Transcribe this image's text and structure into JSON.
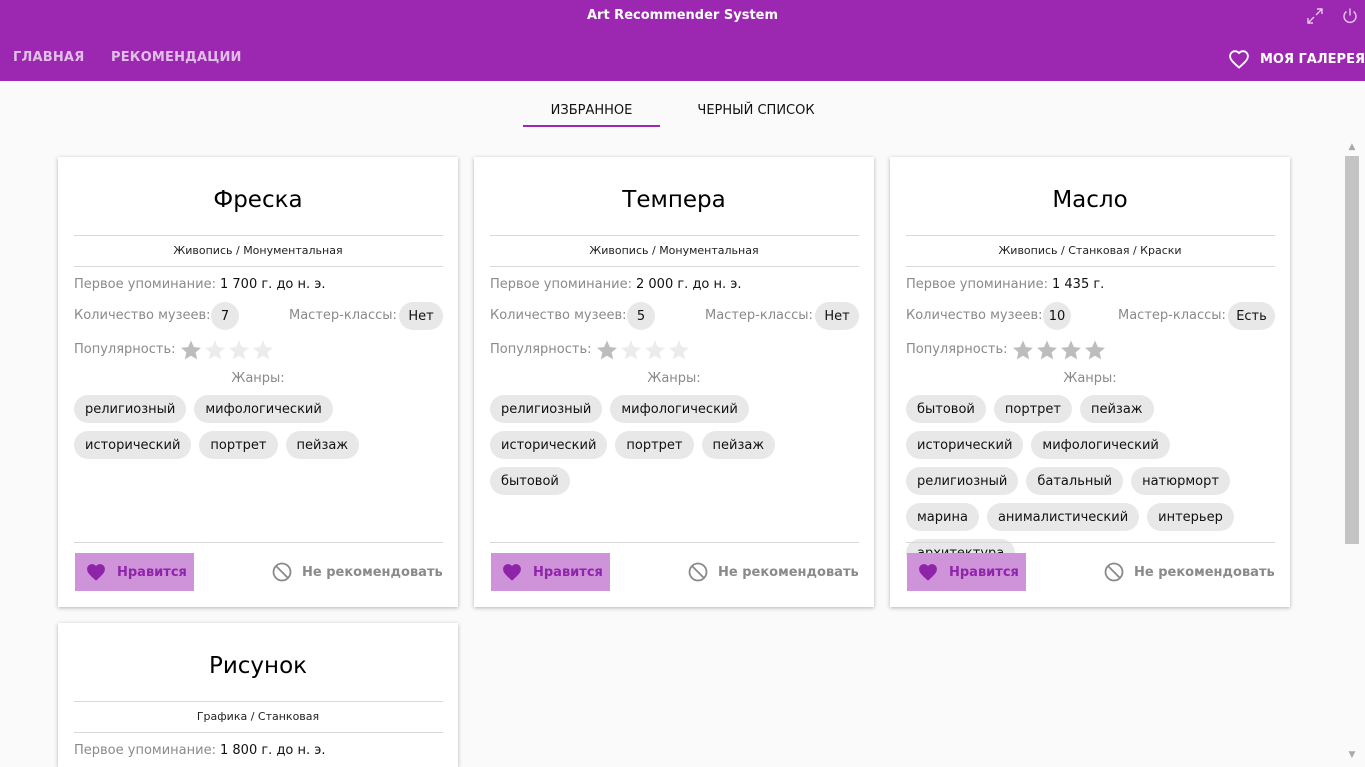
{
  "app": {
    "title": "Art Recommender System"
  },
  "nav": {
    "home": "ГЛАВНАЯ",
    "recommendations": "РЕКОМЕНДАЦИИ",
    "my_gallery": "МОЯ ГАЛЕРЕЯ"
  },
  "tabs": [
    {
      "label": "ИЗБРАННОЕ",
      "active": true
    },
    {
      "label": "ЧЕРНЫЙ СПИСОК",
      "active": false
    }
  ],
  "labels": {
    "first_mention": "Первое упоминание:",
    "museums": "Количество музеев:",
    "masterclasses": "Мастер-классы:",
    "popularity": "Популярность:",
    "genres": "Жанры:",
    "like": "Нравится",
    "not_recommend": "Не рекомендовать"
  },
  "colors": {
    "accent": "#9c27b0",
    "like_bg": "#ce93d8",
    "like_fg": "#8e24aa"
  },
  "cards": [
    {
      "title": "Фреска",
      "category": "Живопись / Монументальная",
      "first_mention": "1 700 г. до н. э.",
      "museums": "7",
      "masterclasses": "Нет",
      "popularity": 1,
      "genres": [
        "религиозный",
        "мифологический",
        "исторический",
        "портрет",
        "пейзаж"
      ]
    },
    {
      "title": "Темпера",
      "category": "Живопись / Монументальная",
      "first_mention": "2 000 г. до н. э.",
      "museums": "5",
      "masterclasses": "Нет",
      "popularity": 1,
      "genres": [
        "религиозный",
        "мифологический",
        "исторический",
        "портрет",
        "пейзаж",
        "бытовой"
      ]
    },
    {
      "title": "Масло",
      "category": "Живопись / Станковая / Краски",
      "first_mention": "1 435 г.",
      "museums": "10",
      "masterclasses": "Есть",
      "popularity": 4,
      "genres": [
        "бытовой",
        "портрет",
        "пейзаж",
        "исторический",
        "мифологический",
        "религиозный",
        "батальный",
        "натюрморт",
        "марина",
        "анималистический",
        "интерьер",
        "архитектура"
      ]
    },
    {
      "title": "Рисунок",
      "category": "Графика / Станковая",
      "first_mention": "1 800 г. до н. э."
    }
  ]
}
